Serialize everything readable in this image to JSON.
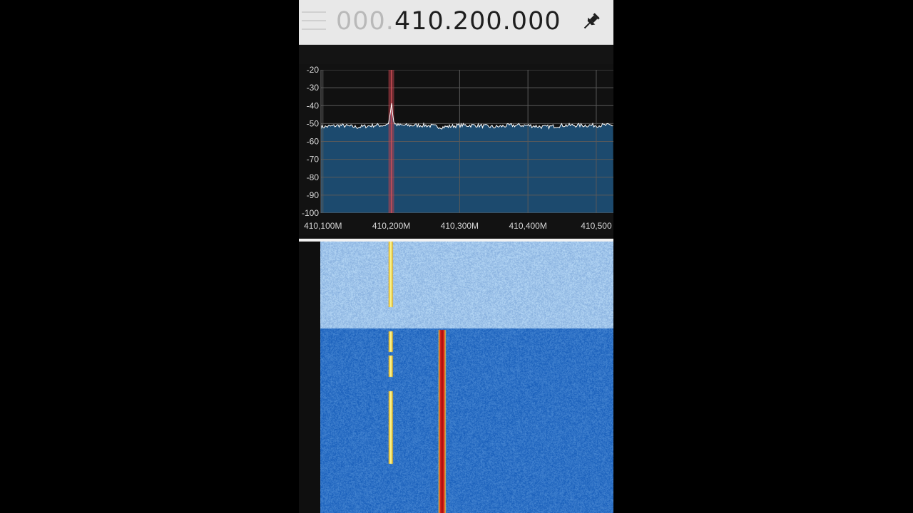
{
  "frequency_display": {
    "leading_digits": "000.",
    "active_digits": "410.200.000"
  },
  "icons": {
    "pin": "pin-icon",
    "drag_handle": "drag-handle-icon"
  },
  "spectrum": {
    "db_labels": [
      "-20",
      "-30",
      "-40",
      "-50",
      "-60",
      "-70",
      "-80",
      "-90",
      "-100"
    ],
    "freq_labels": [
      "410,100M",
      "410,200M",
      "410,300M",
      "410,400M",
      "410,500"
    ],
    "plot_fill_color": "#1c4a6e",
    "trace_color": "#ffffff",
    "tuning_marker_color": "#c0404a",
    "grid_color": "#5a5a5a"
  },
  "chart_data": {
    "type": "line",
    "title": "",
    "xlabel": "",
    "ylabel": "",
    "x_unit": "MHz",
    "y_unit": "dB",
    "xlim": [
      410.0971,
      410.5251
    ],
    "ylim": [
      -100,
      -20
    ],
    "grid": true,
    "series": [
      {
        "x": [
          410.0971,
          410.125,
          410.15,
          410.175,
          410.19,
          410.196,
          410.199,
          410.2,
          410.201,
          410.204,
          410.21,
          410.225,
          410.25,
          410.275,
          410.3,
          410.325,
          410.35,
          410.375,
          410.4,
          410.425,
          410.45,
          410.475,
          410.5,
          410.5251
        ],
        "values": [
          -52,
          -51,
          -52,
          -51,
          -51,
          -50,
          -43,
          -36,
          -42,
          -50,
          -51,
          -51,
          -51,
          -52,
          -51,
          -51,
          -52,
          -51,
          -51,
          -52,
          -51,
          -51,
          -51,
          -51
        ]
      }
    ],
    "tuning_frequency_mhz": 410.2
  },
  "waterfall": {
    "background_color_old": "#9fc4ea",
    "background_color_recent": "#2f72c6",
    "signals": [
      {
        "frequency_mhz": 410.2,
        "color": "#f2e44a",
        "segments": "intermittent"
      },
      {
        "frequency_mhz": 410.275,
        "color": "#d81f1a",
        "segments": "continuous"
      }
    ]
  }
}
